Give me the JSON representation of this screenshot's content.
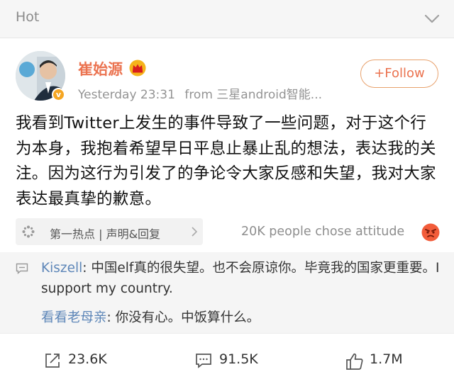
{
  "header": {
    "title": "Hot",
    "collapse_icon": "chevron-down-icon"
  },
  "post": {
    "author": "崔始源",
    "author_badge_icon": "crown-icon",
    "verified_icon": "verified-badge-icon",
    "timestamp": "Yesterday 23:31",
    "source": "from 三星android智能...",
    "follow_label": "+Follow",
    "text": "我看到Twitter上发生的事件导致了一些问题，对于这个行为本身，我抱着希望早日平息止暴止乱的想法，表达我的关注。因为这行为引发了的争论令大家反感和失望，我对大家表达最真挚的歉意。"
  },
  "topic": {
    "label": "第一热点 | 声明&回复",
    "icon": "hotspot-icon"
  },
  "attitude": {
    "text": "20K people chose attitude",
    "icon": "angry-face-icon"
  },
  "comments": [
    {
      "author": "Kiszell",
      "text": ": 中国elf真的很失望。也不会原谅你。毕竟我的国家更重要。I support my country."
    },
    {
      "author": "看看老母亲",
      "text": ": 你没有心。中饭算什么。"
    }
  ],
  "actions": {
    "repost": "23.6K",
    "comment": "91.5K",
    "like": "1.7M"
  },
  "colors": {
    "accent": "#eb7350",
    "link": "#5d86b8",
    "muted": "#939393",
    "badge": "#f5a623"
  }
}
